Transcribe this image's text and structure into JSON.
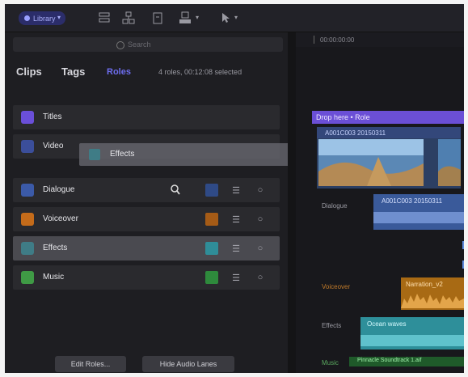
{
  "toolbar": {
    "library_label": "Library",
    "icons": [
      "grid-view-icon",
      "hierarchy-icon",
      "clipboard-icon",
      "person-icon",
      "pointer-tool-icon"
    ]
  },
  "browser": {
    "search_placeholder": "Search",
    "tabs": [
      "Clips",
      "Tags",
      "Roles"
    ],
    "status_text": "4 roles, 00:12:08 selected",
    "rows": [
      {
        "label": "Titles",
        "color": "#6a4fd8"
      },
      {
        "label": "Video",
        "color": "#3b4e9a"
      },
      {
        "label": "Dialogue",
        "color": "#3b5aa8"
      },
      {
        "label": "Voiceover",
        "color": "#c46b1a"
      },
      {
        "label": "Effects",
        "color": "#3f7c86"
      },
      {
        "label": "Music",
        "color": "#3f9a45"
      }
    ],
    "drag_label": "Effects",
    "buttons": {
      "edit_roles": "Edit Roles...",
      "hide_lanes": "Hide Audio Lanes"
    }
  },
  "timeline": {
    "timecode": "00:00:00:00",
    "drop_label": "Drop here • Role",
    "video_clip_title": "A001C003 20150311",
    "dialogue_label": "Dialogue",
    "dialogue_clip": "A001C003 20150311",
    "voiceover_label": "Voiceover",
    "voiceover_clip": "Narration_v2",
    "effects_label": "Effects",
    "effects_clip": "Ocean waves",
    "music_label": "Music",
    "music_clip": "Pinnacle Soundtrack 1.aif"
  }
}
